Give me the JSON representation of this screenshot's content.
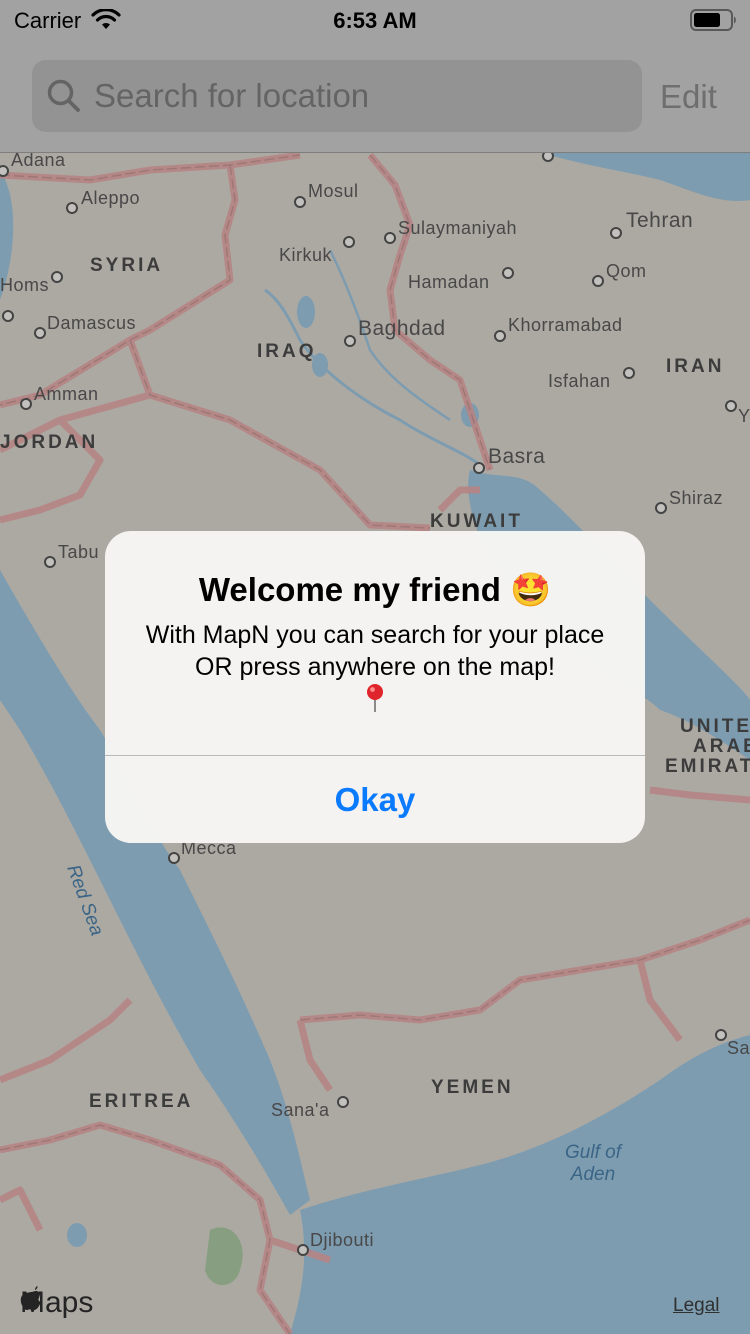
{
  "status_bar": {
    "carrier": "Carrier",
    "time": "6:53 AM"
  },
  "search": {
    "placeholder": "Search for location",
    "edit_label": "Edit"
  },
  "map": {
    "countries": {
      "syria": "SYRIA",
      "iraq": "IRAQ",
      "iran": "IRAN",
      "jordan": "JORDAN",
      "kuwait": "KUWAIT",
      "uae_line1": "UNITE",
      "uae_line2": "ARAB",
      "uae_line3": "EMIRAT",
      "eritrea": "ERITREA",
      "yemen": "YEMEN"
    },
    "cities": {
      "adana": "Adana",
      "aleppo": "Aleppo",
      "mosul": "Mosul",
      "sulaymaniyah": "Sulaymaniyah",
      "tehran": "Tehran",
      "kirkuk": "Kirkuk",
      "homs": "Homs",
      "hamadan": "Hamadan",
      "qom": "Qom",
      "damascus": "Damascus",
      "baghdad": "Baghdad",
      "khorramabad": "Khorramabad",
      "isfahan": "Isfahan",
      "amman": "Amman",
      "basra": "Basra",
      "shiraz": "Shiraz",
      "tabuk": "Tabu",
      "mecca": "Mecca",
      "sanaa": "Sana'a",
      "djibouti": "Djibouti",
      "sa": "Sa",
      "y": "Y"
    },
    "water": {
      "red_sea": "Red Sea",
      "gulf_line1": "Gulf of",
      "gulf_line2": "Aden"
    },
    "branding": {
      "maps": "Maps",
      "legal": "Legal"
    }
  },
  "alert": {
    "title": "Welcome my friend 🤩",
    "message": "With MapN you can search for your place OR press anywhere on the map!",
    "button": "Okay"
  },
  "colors": {
    "accent": "#0a7aff",
    "water": "#9dc3dc",
    "land": "#d8d4cc",
    "border": "#e3a6a6"
  }
}
